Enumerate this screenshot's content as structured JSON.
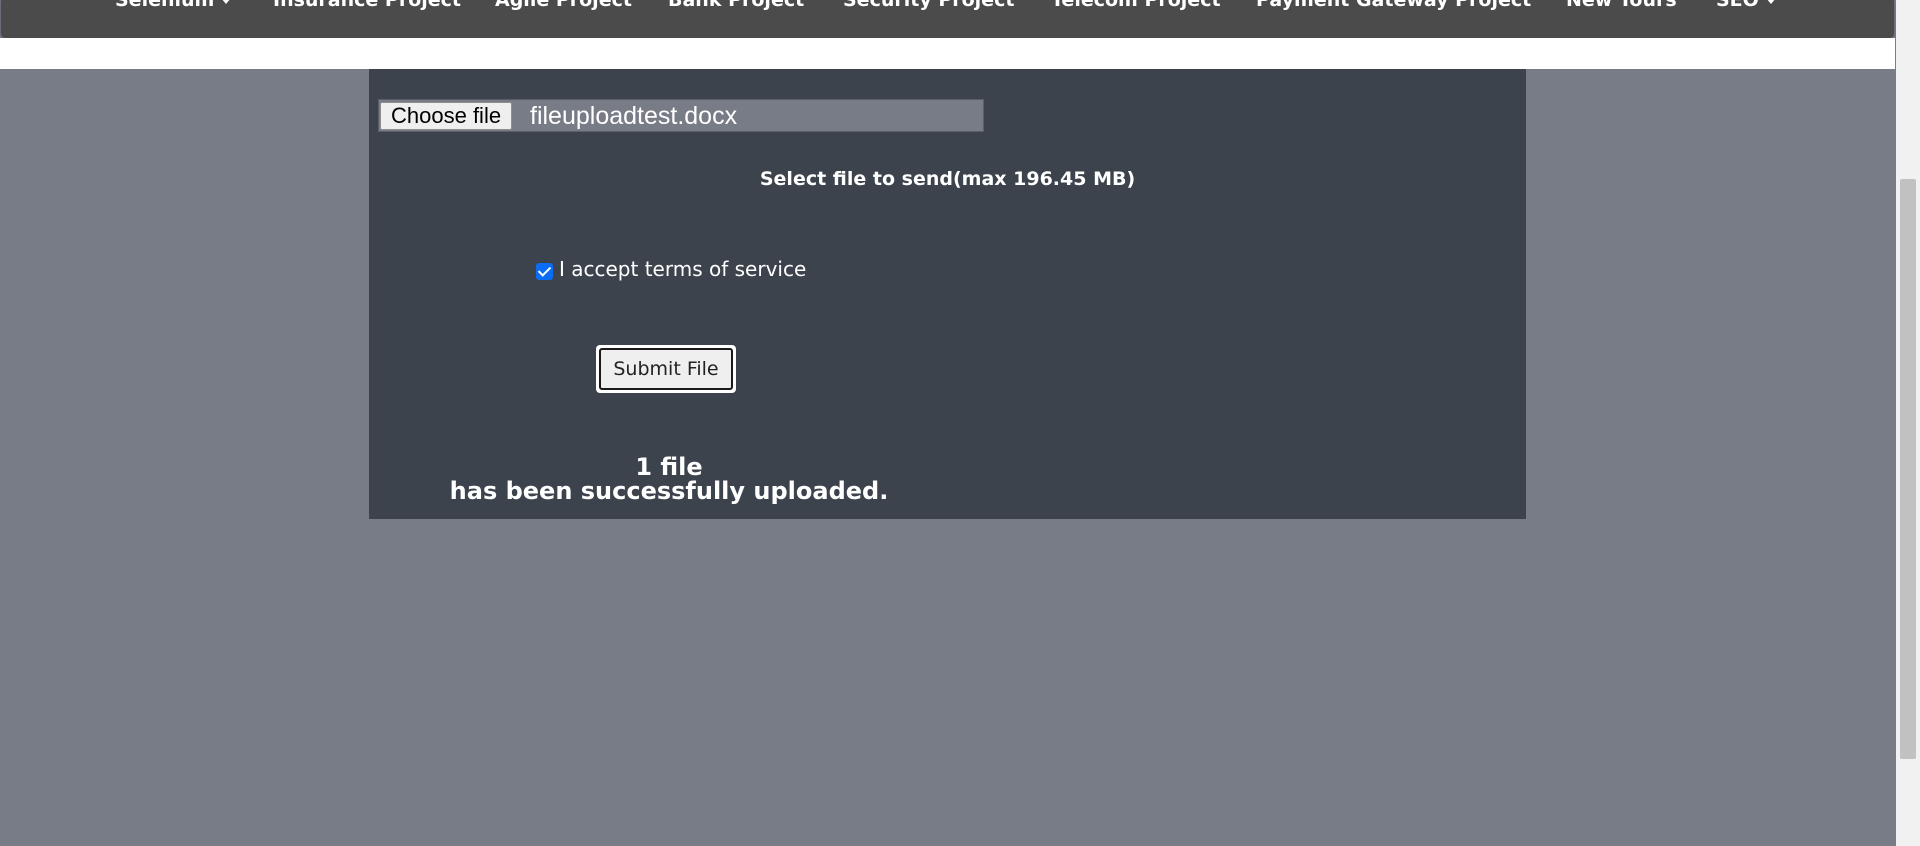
{
  "nav": {
    "items": [
      {
        "label": "Selenium",
        "dropdown": true
      },
      {
        "label": "Insurance Project",
        "dropdown": false
      },
      {
        "label": "Agile Project",
        "dropdown": false
      },
      {
        "label": "Bank Project",
        "dropdown": false
      },
      {
        "label": "Security Project",
        "dropdown": false
      },
      {
        "label": "Telecom Project",
        "dropdown": false
      },
      {
        "label": "Payment Gateway Project",
        "dropdown": false
      },
      {
        "label": "New Tours",
        "dropdown": false
      },
      {
        "label": "SEO",
        "dropdown": true
      }
    ]
  },
  "upload": {
    "choose_label": "Choose file",
    "file_name": "fileuploadtest.docx",
    "select_label": "Select file to send(max 196.45 MB)",
    "terms_label": "I accept terms of service",
    "terms_checked": true,
    "submit_label": "Submit File",
    "result_line1": "1 file",
    "result_line2": "has been successfully uploaded."
  },
  "colors": {
    "page_background": "#787c87",
    "navbar": "#4b4b4b",
    "panel": "#3c434d",
    "checkbox_accent": "#0b6cf4"
  },
  "icons": {
    "dropdown": "caret-down-icon",
    "checkbox": "checkmark-icon"
  }
}
